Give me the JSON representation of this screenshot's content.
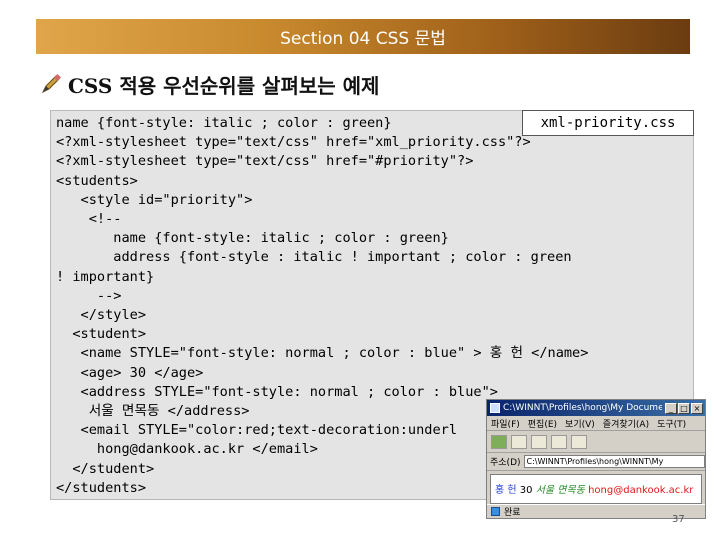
{
  "banner": {
    "title": "Section 04 CSS 문법"
  },
  "heading": {
    "text": "CSS 적용 우선순위를 살펴보는 예제"
  },
  "file_label": "xml-priority.css",
  "code": {
    "lines": [
      "name {font-style: italic ; color : green}",
      "<?xml-stylesheet type=\"text/css\" href=\"xml_priority.css\"?>",
      "<?xml-stylesheet type=\"text/css\" href=\"#priority\"?>",
      "<students>",
      "   <style id=\"priority\">",
      "    <!--",
      "       name {font-style: italic ; color : green}",
      "       address {font-style : italic ! important ; color : green",
      "! important}",
      "     -->",
      "   </style>",
      "  <student>",
      "   <name STYLE=\"font-style: normal ; color : blue\" > 홍 헌 </name>",
      "   <age> 30 </age>",
      "   <address STYLE=\"font-style: normal ; color : blue\">",
      "    서울 면목동 </address>",
      "   <email STYLE=\"color:red;text-decoration:underl",
      "     hong@dankook.ac.kr </email>",
      "  </student>",
      "</students>"
    ]
  },
  "browser": {
    "title": "C:\\WINNT\\Profiles\\hong\\My Documents\\...",
    "menu": [
      "파일(F)",
      "편집(E)",
      "보기(V)",
      "즐겨찾기(A)",
      "도구(T)"
    ],
    "address_label": "주소(D)",
    "address_value": "C:\\WINNT\\Profiles\\hong\\WINNT\\My",
    "content_name": "홍 헌",
    "content_age": "30",
    "content_address": "서울 면목동",
    "content_email": "hong@dankook.ac.kr",
    "status": "완료",
    "colors": {
      "name": "#1f3bd8",
      "address": "#2a8a2a",
      "email": "#e01818"
    }
  },
  "page_number": "37"
}
